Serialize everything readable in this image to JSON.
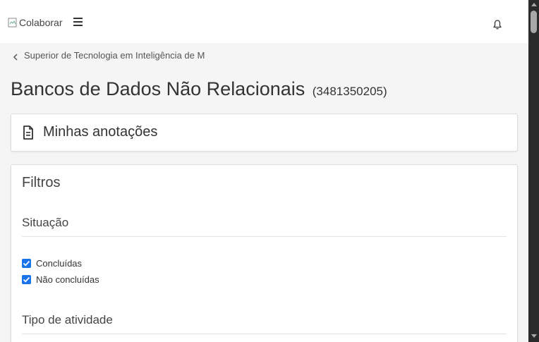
{
  "header": {
    "logo_alt": "Colaborar",
    "menu_icon": "hamburger-menu-icon",
    "notification_icon": "bell-icon"
  },
  "breadcrumb": {
    "back_label": "Superior de Tecnologia em Inteligência de M"
  },
  "page": {
    "title": "Bancos de Dados Não Relacionais",
    "code": "(3481350205)"
  },
  "notes_card": {
    "icon": "document-icon",
    "label": "Minhas anotações"
  },
  "filters": {
    "title": "Filtros",
    "situacao": {
      "title": "Situação",
      "options": [
        {
          "label": "Concluídas",
          "checked": true
        },
        {
          "label": "Não concluídas",
          "checked": true
        }
      ]
    },
    "tipo_atividade": {
      "title": "Tipo de atividade"
    }
  },
  "colors": {
    "checkbox_accent": "#1a73e8",
    "page_background": "#f5f5f5",
    "scrollbar": "#2b2b2b"
  }
}
